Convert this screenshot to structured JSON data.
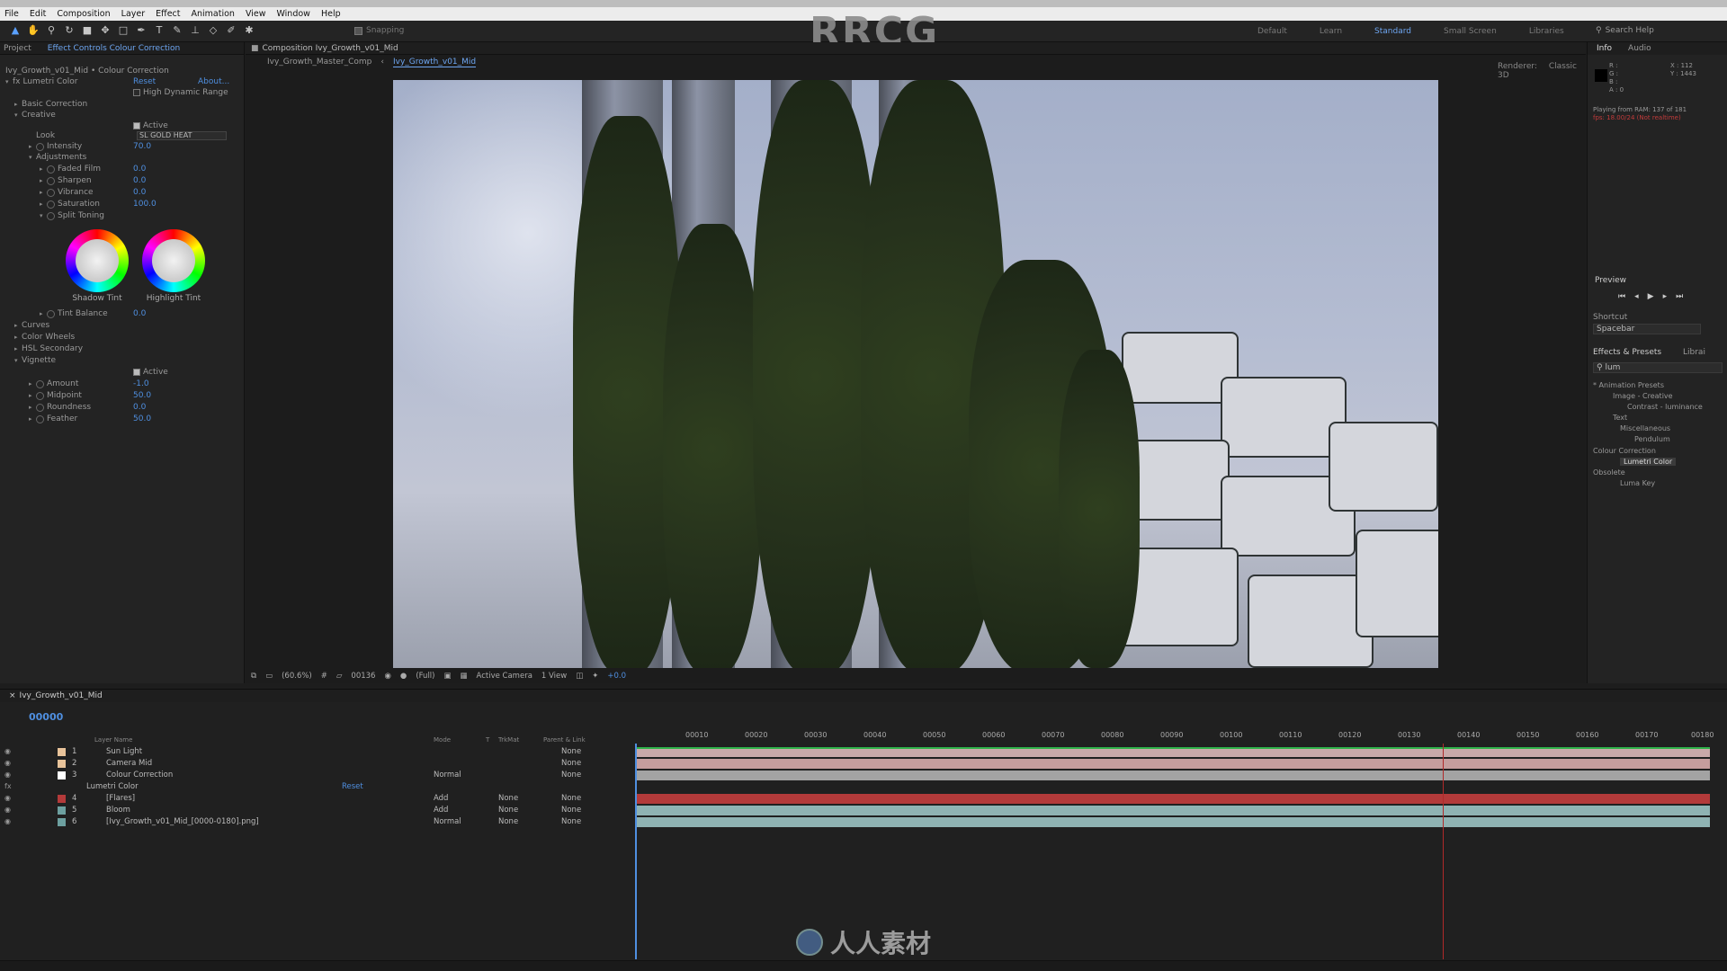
{
  "app": {
    "logo_text": "RRCG"
  },
  "menu": [
    "File",
    "Edit",
    "Composition",
    "Layer",
    "Effect",
    "Animation",
    "View",
    "Window",
    "Help"
  ],
  "toolbar": {
    "snapping_label": "Snapping",
    "workspaces": [
      "Default",
      "Learn",
      "Standard",
      "Small Screen",
      "Libraries"
    ],
    "active_workspace": "Standard",
    "search_help": "Search Help"
  },
  "left_panel": {
    "tabs": [
      "Project",
      "Effect Controls Colour Correction"
    ],
    "breadcrumb": "Ivy_Growth_v01_Mid • Colour Correction",
    "effect_name": "Lumetri Color",
    "reset": "Reset",
    "about": "About...",
    "hdr_label": "High Dynamic Range",
    "sections": {
      "basic": "Basic Correction",
      "creative": "Creative",
      "active_label": "Active",
      "look_label": "Look",
      "look_value": "SL GOLD HEAT",
      "intensity_label": "Intensity",
      "intensity_value": "70.0",
      "adjustments": "Adjustments",
      "faded_film_label": "Faded Film",
      "faded_film_value": "0.0",
      "sharpen_label": "Sharpen",
      "sharpen_value": "0.0",
      "vibrance_label": "Vibrance",
      "vibrance_value": "0.0",
      "saturation_label": "Saturation",
      "saturation_value": "100.0",
      "split_toning": "Split Toning",
      "shadow_tint": "Shadow Tint",
      "highlight_tint": "Highlight Tint",
      "tint_balance_label": "Tint Balance",
      "tint_balance_value": "0.0",
      "curves": "Curves",
      "color_wheels": "Color Wheels",
      "hsl_secondary": "HSL Secondary",
      "vignette": "Vignette",
      "vig_active": "Active",
      "amount_label": "Amount",
      "amount_value": "-1.0",
      "midpoint_label": "Midpoint",
      "midpoint_value": "50.0",
      "roundness_label": "Roundness",
      "roundness_value": "0.0",
      "feather_label": "Feather",
      "feather_value": "50.0"
    }
  },
  "comp_panel": {
    "tab": "Composition Ivy_Growth_v01_Mid",
    "breadcrumbs": [
      "Ivy_Growth_Master_Comp",
      "Ivy_Growth_v01_Mid"
    ],
    "renderer_label": "Renderer:",
    "renderer_value": "Classic 3D",
    "zoom": "(60.6%)",
    "timecode": "00136",
    "resolution": "(Full)",
    "camera": "Active Camera",
    "views": "1 View",
    "exposure": "+0.0"
  },
  "right_panel": {
    "tabs": [
      "Info",
      "Audio"
    ],
    "info_rgb": [
      "R :",
      "G :",
      "B :",
      "A : 0"
    ],
    "info_xy": [
      "X : 112",
      "Y : 1443"
    ],
    "playing": "Playing from RAM: 137 of 181",
    "playing_warn": "fps: 18.00/24 (Not realtime)",
    "preview_label": "Preview",
    "shortcut_label": "Shortcut",
    "shortcut_value": "Spacebar",
    "effects_tabs": [
      "Effects & Presets",
      "Librai"
    ],
    "search_value": "lum",
    "tree": [
      "* Animation Presets",
      "Image - Creative",
      "Contrast - luminance",
      "Text",
      "Miscellaneous",
      "Pendulum",
      "Colour Correction",
      "Lumetri Color",
      "Obsolete",
      "Luma Key"
    ]
  },
  "timeline": {
    "comp_name": "Ivy_Growth_v01_Mid",
    "timecode": "00000",
    "columns": {
      "layer_name": "Layer Name",
      "mode": "Mode",
      "t": "T",
      "trkmat": "TrkMat",
      "parent": "Parent & Link"
    },
    "layers": [
      {
        "num": "1",
        "name": "Sun Light",
        "mode": "",
        "trk": "",
        "parent": "None",
        "color": "#e8c39a"
      },
      {
        "num": "2",
        "name": "Camera Mid",
        "mode": "",
        "trk": "",
        "parent": "None",
        "color": "#e8c39a"
      },
      {
        "num": "3",
        "name": "Colour Correction",
        "mode": "Normal",
        "trk": "",
        "parent": "None",
        "color": "#ffffff"
      },
      {
        "num": "",
        "name": "Lumetri Color",
        "mode": "",
        "trk": "",
        "parent": "",
        "color": ""
      },
      {
        "num": "4",
        "name": "[Flares]",
        "mode": "Add",
        "trk": "None",
        "parent": "None",
        "color": "#b33a3a"
      },
      {
        "num": "5",
        "name": "Bloom",
        "mode": "Add",
        "trk": "None",
        "parent": "None",
        "color": "#6da0a0"
      },
      {
        "num": "6",
        "name": "[Ivy_Growth_v01_Mid_[0000-0180].png]",
        "mode": "Normal",
        "trk": "None",
        "parent": "None",
        "color": "#6da0a0"
      }
    ],
    "lumetri_reset": "Reset",
    "ruler": [
      "00010",
      "00020",
      "00030",
      "00040",
      "00050",
      "00060",
      "00070",
      "00080",
      "00090",
      "00100",
      "00110",
      "00120",
      "00130",
      "00140",
      "00150",
      "00160",
      "00170",
      "00180"
    ]
  },
  "watermark": {
    "text": "人人素材"
  }
}
